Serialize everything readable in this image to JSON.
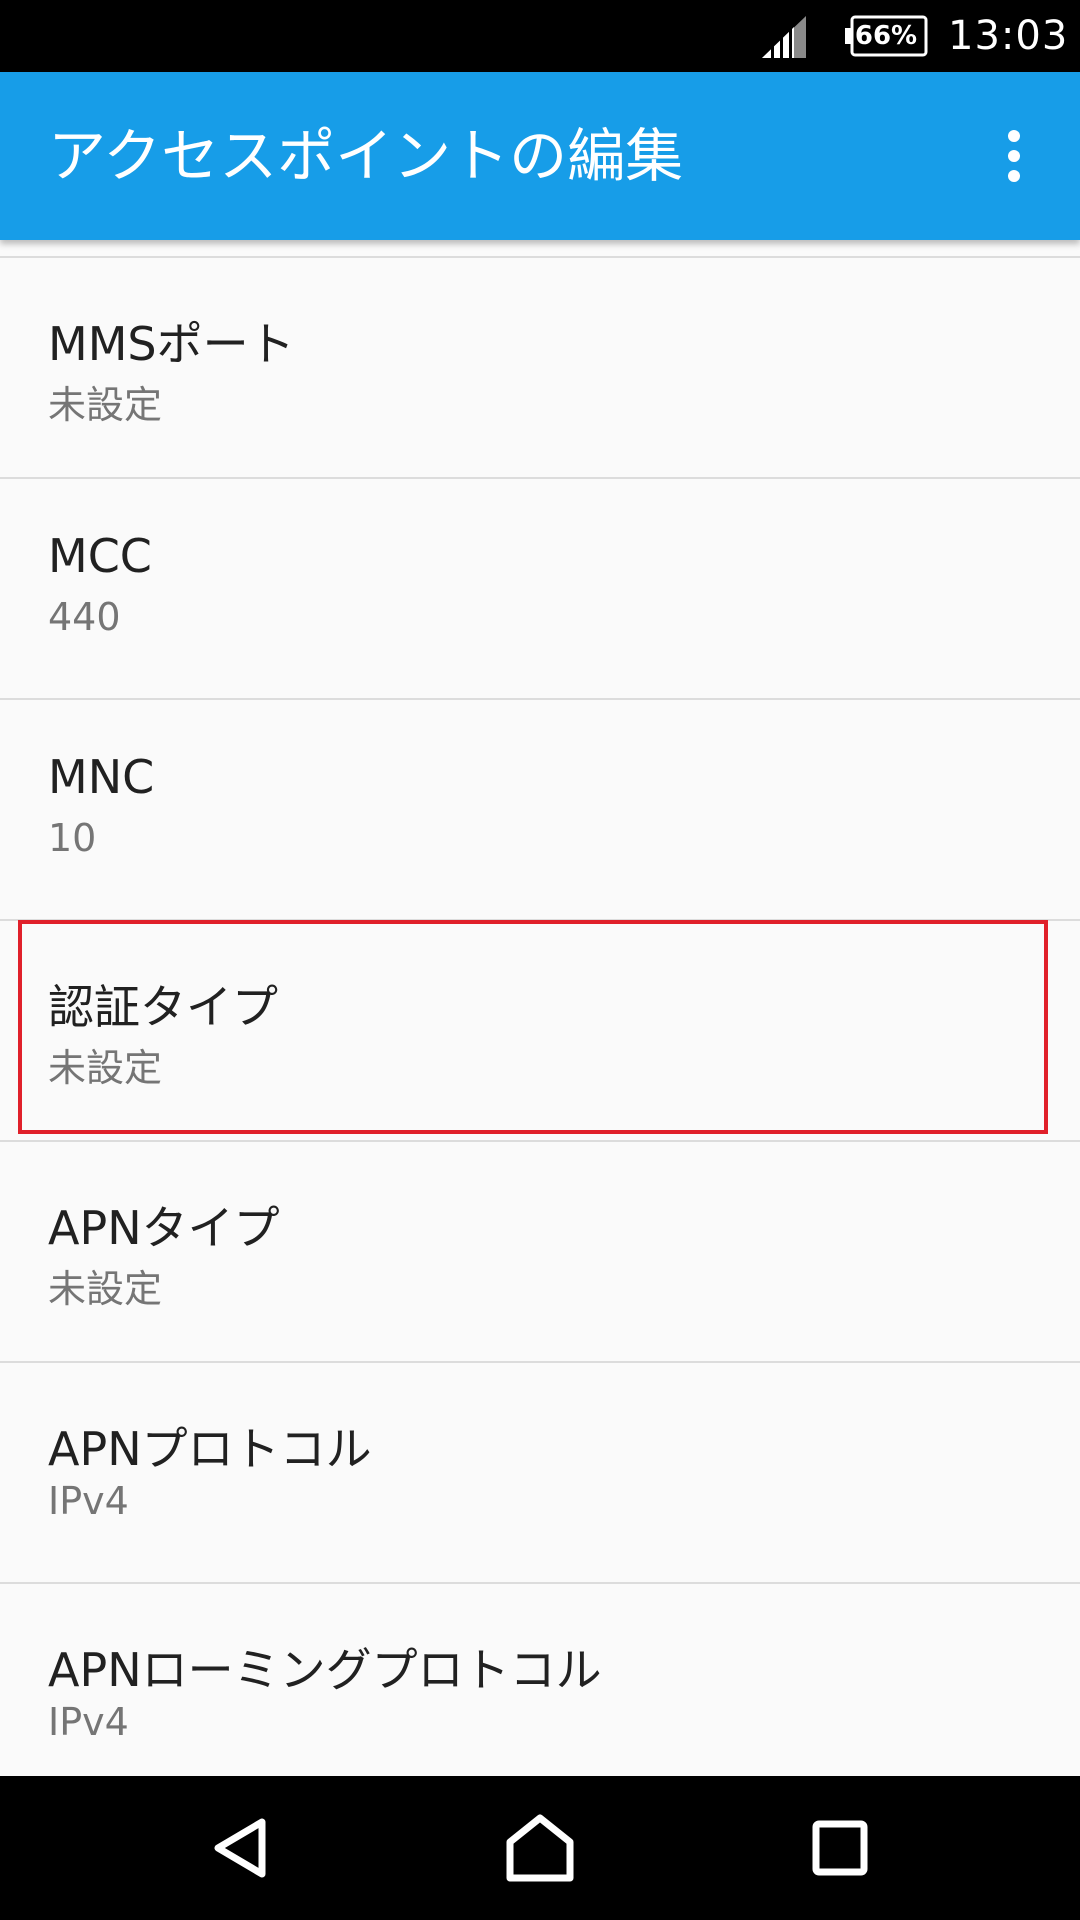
{
  "status_bar": {
    "battery": "66%",
    "time": "13:03",
    "icons": [
      "signal-icon",
      "battery-icon"
    ]
  },
  "app_bar": {
    "title": "アクセスポイントの編集",
    "menu_icon": "more-vert-icon"
  },
  "settings": [
    {
      "label": "MMSポート",
      "value": "未設定"
    },
    {
      "label": "MCC",
      "value": "440"
    },
    {
      "label": "MNC",
      "value": "10"
    },
    {
      "label": "認証タイプ",
      "value": "未設定"
    },
    {
      "label": "APNタイプ",
      "value": "未設定"
    },
    {
      "label": "APNプロトコル",
      "value": "IPv4"
    },
    {
      "label": "APNローミングプロトコル",
      "value": "IPv4"
    }
  ],
  "highlight_color": "#e0202a",
  "accent_color": "#179de8",
  "nav_bar": {
    "icons": [
      "back-icon",
      "home-icon",
      "recents-icon"
    ]
  }
}
